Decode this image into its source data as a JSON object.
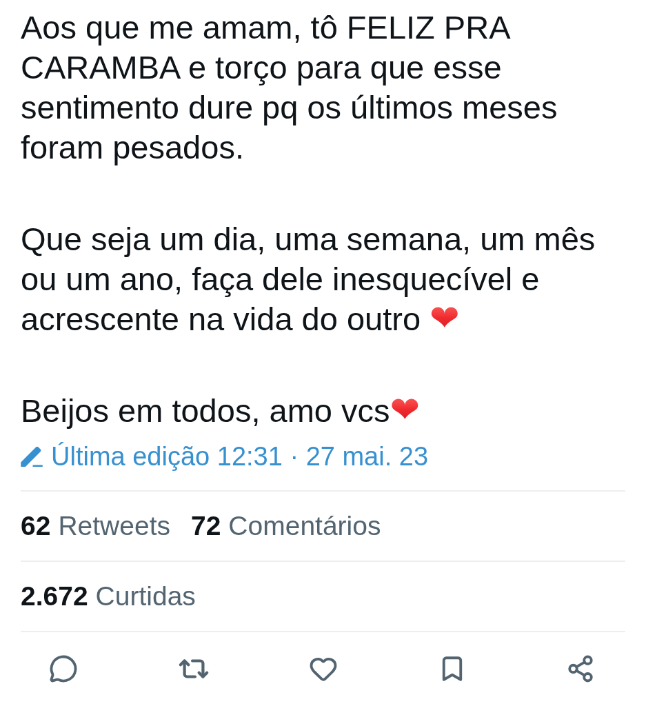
{
  "tweet": {
    "paragraphs": [
      "Aos que me amam, tô FELIZ PRA CARAMBA e torço para que esse sentimento dure pq os últimos meses foram pesados.",
      "Que seja um dia, uma semana, um mês ou um ano, faça dele inesquecível e acrescente na vida do outro ❤",
      "Beijos em todos, amo vcs❤"
    ],
    "edited": {
      "text": "Última edição 12:31 · 27 mai. 23"
    }
  },
  "stat_rows": [
    {
      "items": [
        {
          "count": "62",
          "label": "Retweets"
        },
        {
          "count": "72",
          "label": "Comentários"
        }
      ]
    },
    {
      "items": [
        {
          "count": "2.672",
          "label": "Curtidas"
        }
      ]
    }
  ]
}
